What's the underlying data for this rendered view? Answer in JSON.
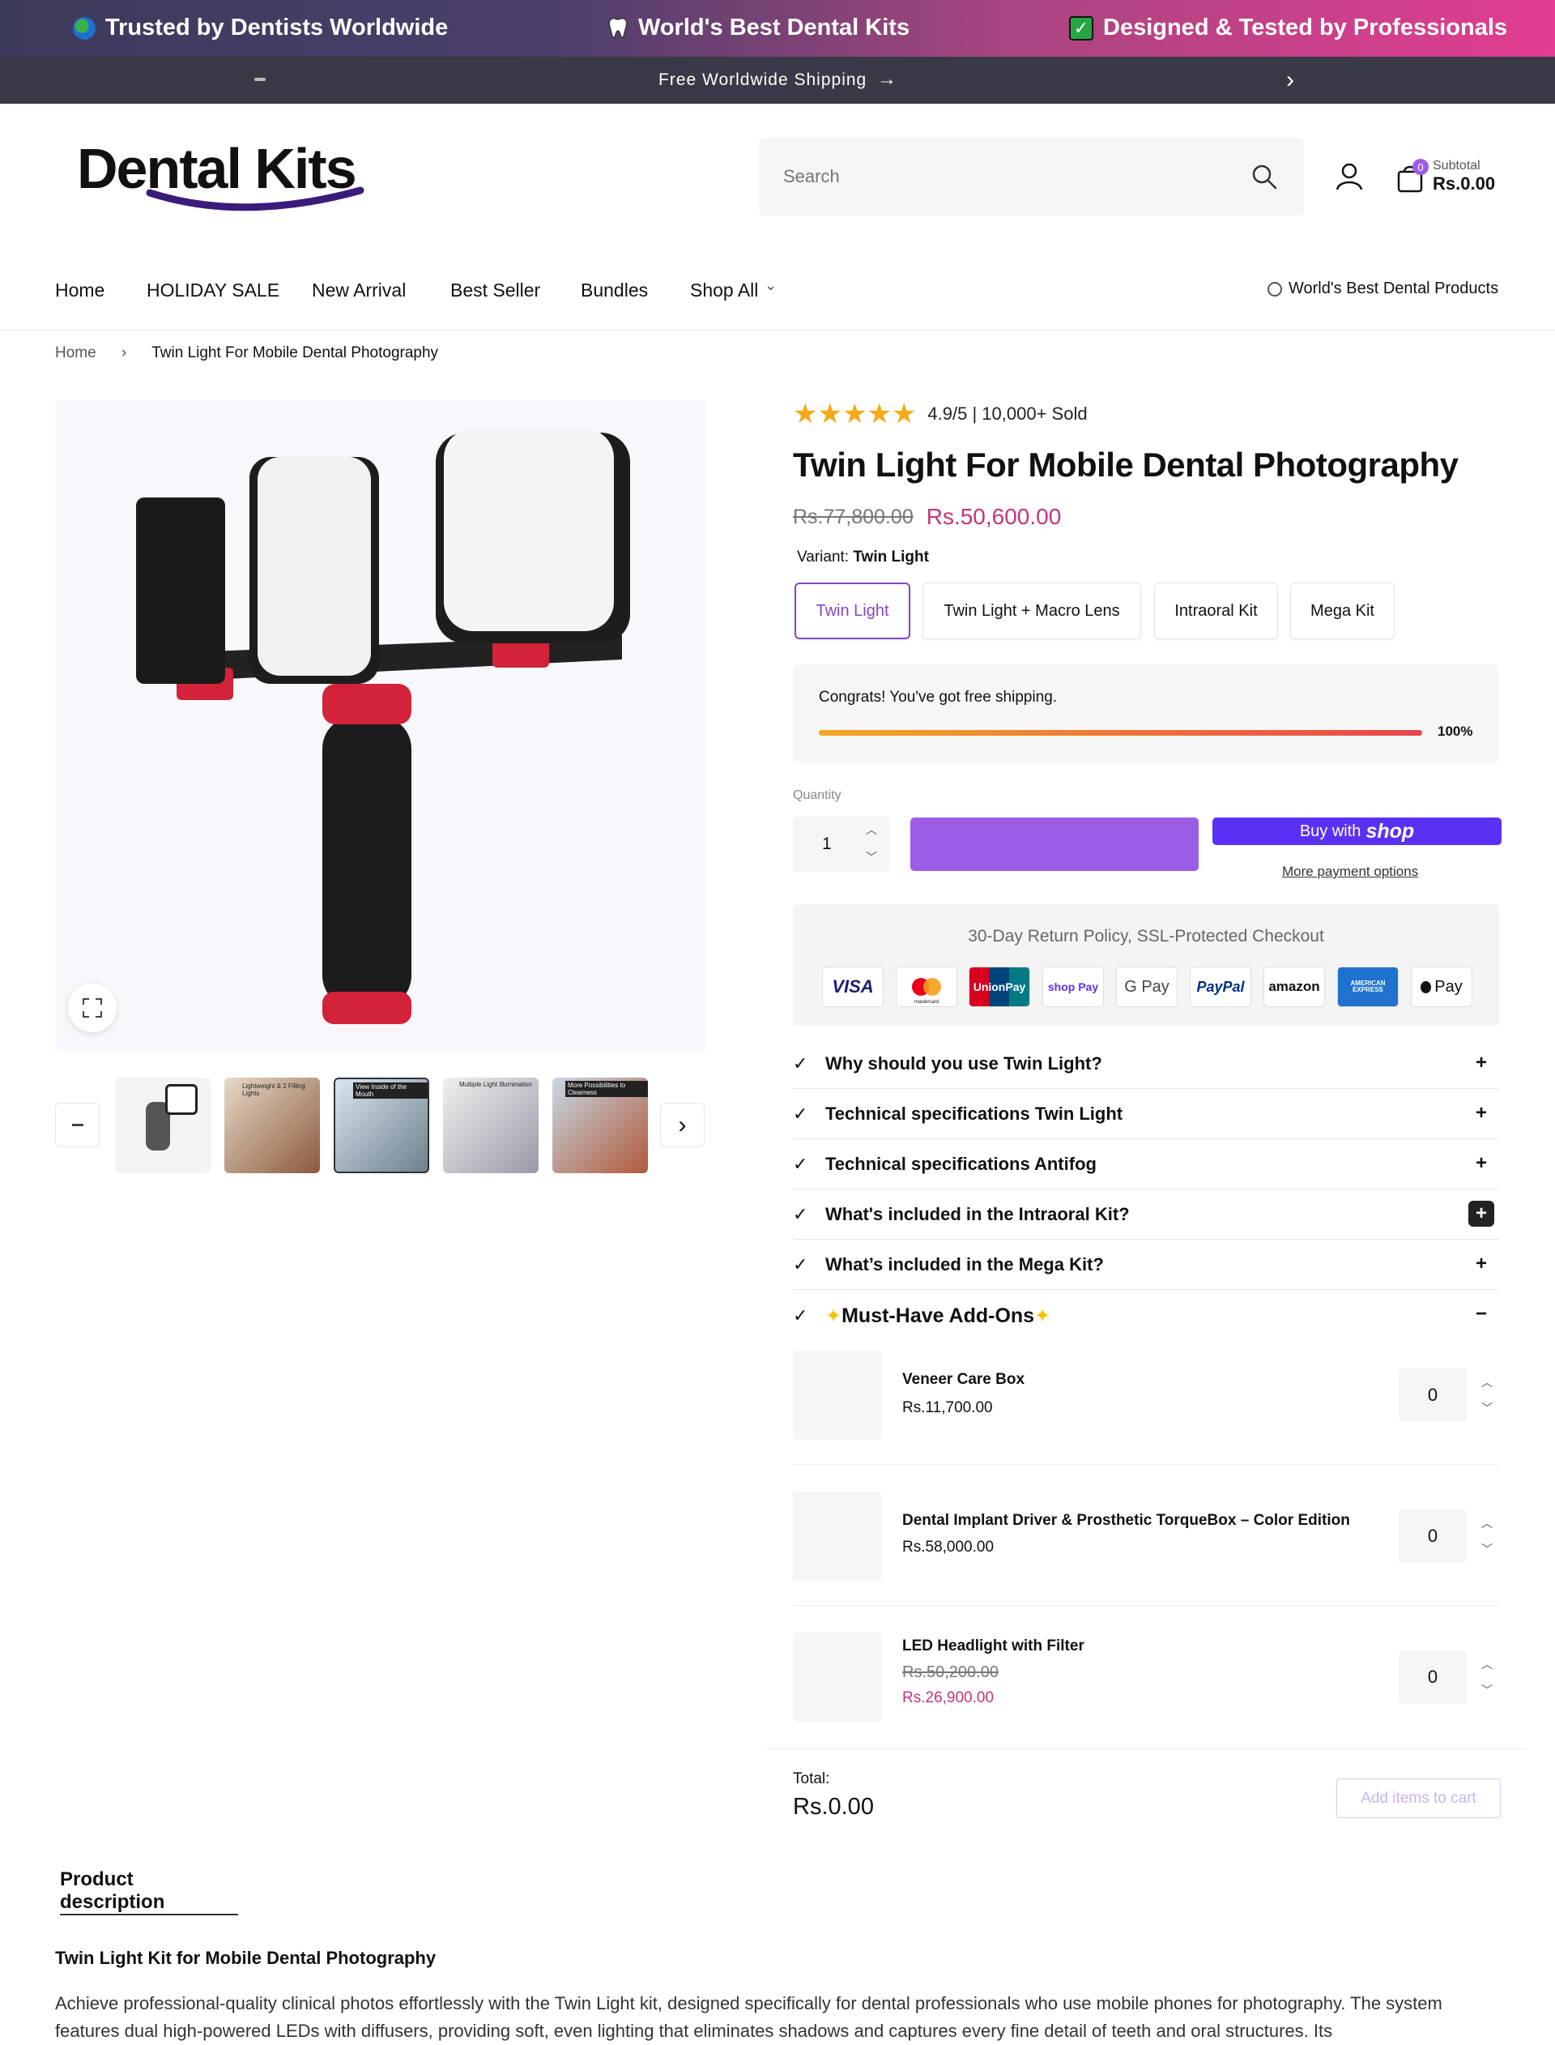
{
  "announcement": {
    "items": [
      {
        "icon": "globe-icon",
        "text": "Trusted by Dentists Worldwide"
      },
      {
        "icon": "tooth-icon",
        "text": "World's Best Dental Kits"
      },
      {
        "icon": "check-box-icon",
        "text": "Designed & Tested by Professionals"
      }
    ],
    "shipping_text": "Free Worldwide Shipping"
  },
  "header": {
    "logo_text": "Dental Kits",
    "search_placeholder": "Search",
    "cart_count": "0",
    "subtotal_label": "Subtotal",
    "subtotal_value": "Rs.0.00"
  },
  "nav": {
    "items": [
      "Home",
      "HOLIDAY SALE",
      "New Arrival",
      "Best Seller",
      "Bundles",
      "Shop All"
    ],
    "right_text": "World's Best Dental Products"
  },
  "breadcrumb": {
    "home": "Home",
    "current": "Twin Light For Mobile Dental Photography"
  },
  "product": {
    "rating_text": "4.9/5 | 10,000+ Sold",
    "rating_stars": 5,
    "title": "Twin Light For Mobile Dental Photography",
    "compare_price": "Rs.77,800.00",
    "price": "Rs.50,600.00",
    "variant_label": "Variant:",
    "variant_selected": "Twin Light",
    "variants": [
      "Twin Light",
      "Twin Light + Macro Lens",
      "Intraoral Kit",
      "Mega Kit"
    ],
    "shipping_msg": "Congrats! You've got free shipping.",
    "shipping_progress": "100%",
    "quantity_label": "Quantity",
    "quantity": "1",
    "buy_with": "Buy with",
    "shop_brand": "shop",
    "more_payment": "More payment options",
    "trust_text": "30-Day Return Policy, SSL-Protected Checkout",
    "payment_methods": [
      "VISA",
      "mastercard",
      "UnionPay",
      "shop Pay",
      "G Pay",
      "PayPal",
      "amazon",
      "AMERICAN EXPRESS",
      "Pay"
    ],
    "thumb_labels": [
      "Lightweight & 2 Filling Lights",
      "View Inside of the Mouth",
      "Multiple Light Illumination",
      "More Possibilities to Clearness"
    ]
  },
  "accordion": [
    {
      "title": "Why should you use Twin Light?",
      "icon": "+"
    },
    {
      "title": "Technical specifications Twin Light",
      "icon": "+"
    },
    {
      "title": "Technical specifications Antifog",
      "icon": "+"
    },
    {
      "title": "What's included in the Intraoral Kit?",
      "icon": "+"
    },
    {
      "title": "What’s included in the Mega Kit?",
      "icon": "+"
    },
    {
      "title": "Must-Have Add-Ons",
      "icon": "−"
    }
  ],
  "addons": [
    {
      "name": "Veneer Care Box",
      "price": "Rs.11,700.00",
      "compare": "",
      "qty": "0"
    },
    {
      "name": "Dental Implant Driver & Prosthetic TorqueBox – Color Edition",
      "price": "Rs.58,000.00",
      "compare": "",
      "qty": "0"
    },
    {
      "name": "LED Headlight with Filter",
      "price": "Rs.26,900.00",
      "compare": "Rs.50,200.00",
      "qty": "0"
    }
  ],
  "total": {
    "label": "Total:",
    "value": "Rs.0.00",
    "button": "Add items to cart"
  },
  "description": {
    "tab": "Product description",
    "heading": "Twin Light Kit for Mobile Dental Photography",
    "body": "Achieve professional-quality clinical photos effortlessly with the Twin Light kit, designed specifically for dental professionals who use mobile phones for photography. The system features dual high-powered LEDs with diffusers, providing soft, even lighting that eliminates shadows and captures every fine detail of teeth and oral structures. Its"
  }
}
